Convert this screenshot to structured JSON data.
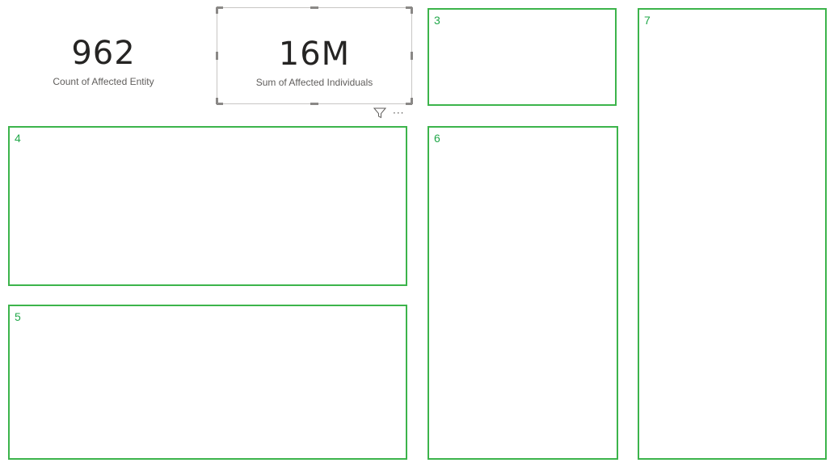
{
  "cards": {
    "count": {
      "value": "962",
      "label": "Count of Affected Entity"
    },
    "sum": {
      "value": "16M",
      "label": "Sum of Affected Individuals"
    }
  },
  "visual_toolbar": {
    "filter_icon": "filter-icon",
    "more_options": "···"
  },
  "placeholders": [
    {
      "id": "3",
      "label": "3"
    },
    {
      "id": "4",
      "label": "4"
    },
    {
      "id": "5",
      "label": "5"
    },
    {
      "id": "6",
      "label": "6"
    },
    {
      "id": "7",
      "label": "7"
    }
  ],
  "colors": {
    "placeholder_border": "#3cb44b",
    "placeholder_number": "#22a84a",
    "card_value": "#252423",
    "card_label": "#605e5c"
  }
}
